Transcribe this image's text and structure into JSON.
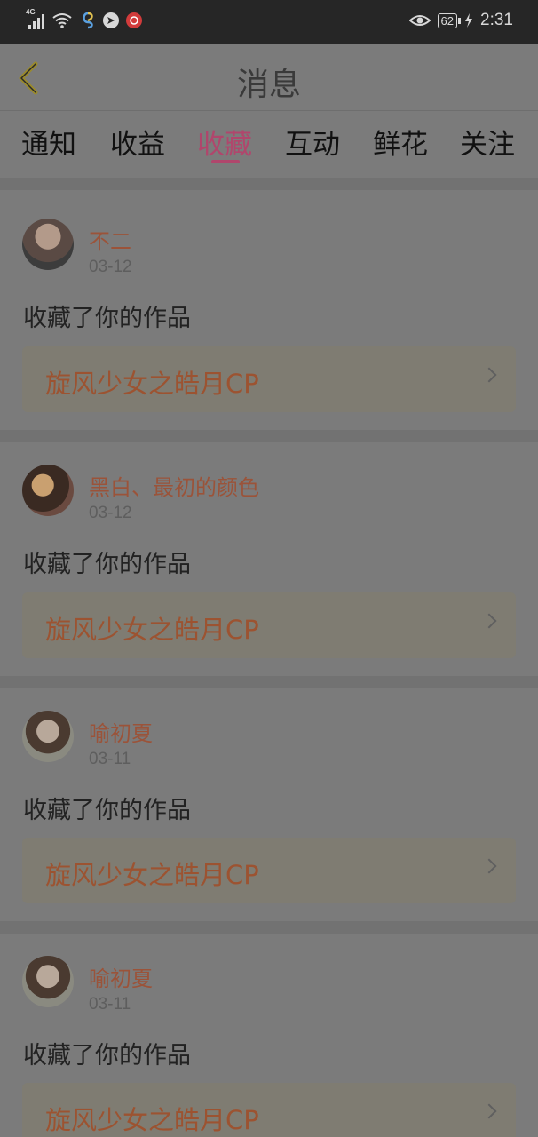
{
  "status_bar": {
    "network": "4G",
    "battery": "62",
    "time": "2:31",
    "icons": [
      "signal-icon",
      "wifi-icon",
      "app-icon",
      "message-icon",
      "netease-icon",
      "eye-icon",
      "charging-icon"
    ]
  },
  "header": {
    "title": "消息",
    "back_icon": "chevron-left-icon"
  },
  "tabs": [
    {
      "label": "通知"
    },
    {
      "label": "收益"
    },
    {
      "label": "收藏",
      "active": true
    },
    {
      "label": "互动"
    },
    {
      "label": "鲜花"
    },
    {
      "label": "关注"
    }
  ],
  "messages": [
    {
      "user": "不二",
      "date": "03-12",
      "action": "收藏了你的作品",
      "work": "旋风少女之皓月CP"
    },
    {
      "user": "黑白、最初的颜色",
      "date": "03-12",
      "action": "收藏了你的作品",
      "work": "旋风少女之皓月CP"
    },
    {
      "user": "喻初夏",
      "date": "03-11",
      "action": "收藏了你的作品",
      "work": "旋风少女之皓月CP"
    },
    {
      "user": "喻初夏",
      "date": "03-11",
      "action": "收藏了你的作品",
      "work": "旋风少女之皓月CP"
    }
  ],
  "colors": {
    "accent_tab": "#b0466c",
    "username": "#9b5339",
    "work_title": "#9c5331"
  }
}
